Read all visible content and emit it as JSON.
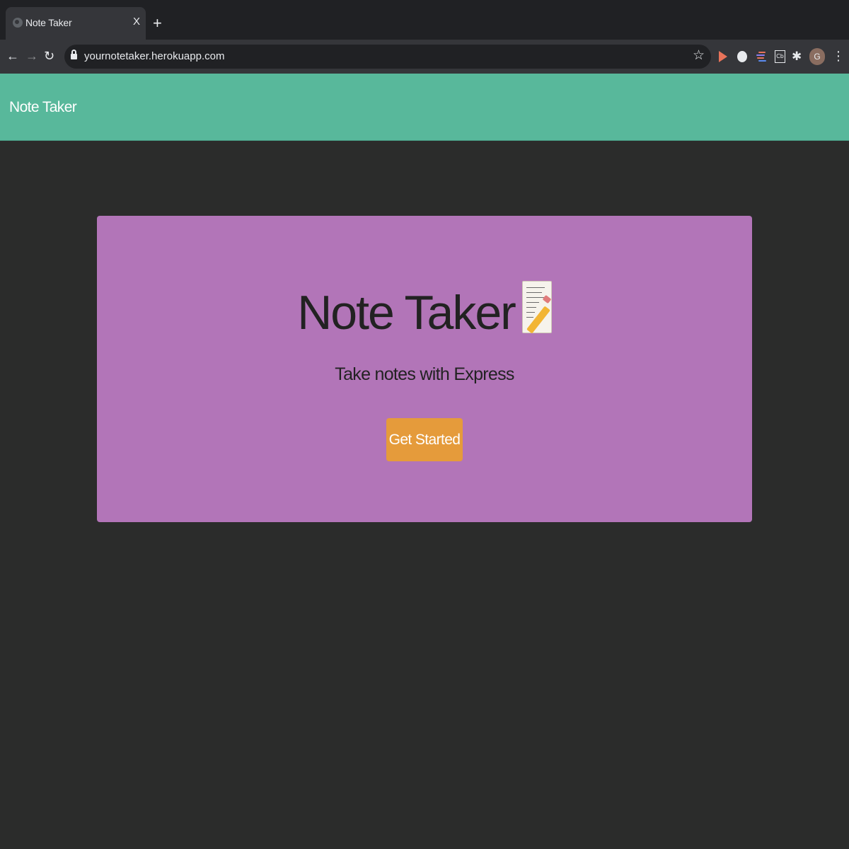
{
  "browser": {
    "tab": {
      "title": "Note Taker",
      "close_glyph": "X"
    },
    "new_tab_glyph": "+",
    "address_bar": {
      "url": "yournotetaker.herokuapp.com"
    },
    "profile_initial": "G",
    "extension_4_label": "Cb"
  },
  "navbar": {
    "brand": "Note Taker"
  },
  "hero": {
    "title": "Note Taker",
    "title_icon": "memo-icon",
    "subtitle": "Take notes with Express",
    "button_label": "Get Started"
  },
  "colors": {
    "page_background": "#2b2c2b",
    "navbar": "#58b89b",
    "jumbotron": "#b275b8",
    "button": "#e59b3b"
  }
}
